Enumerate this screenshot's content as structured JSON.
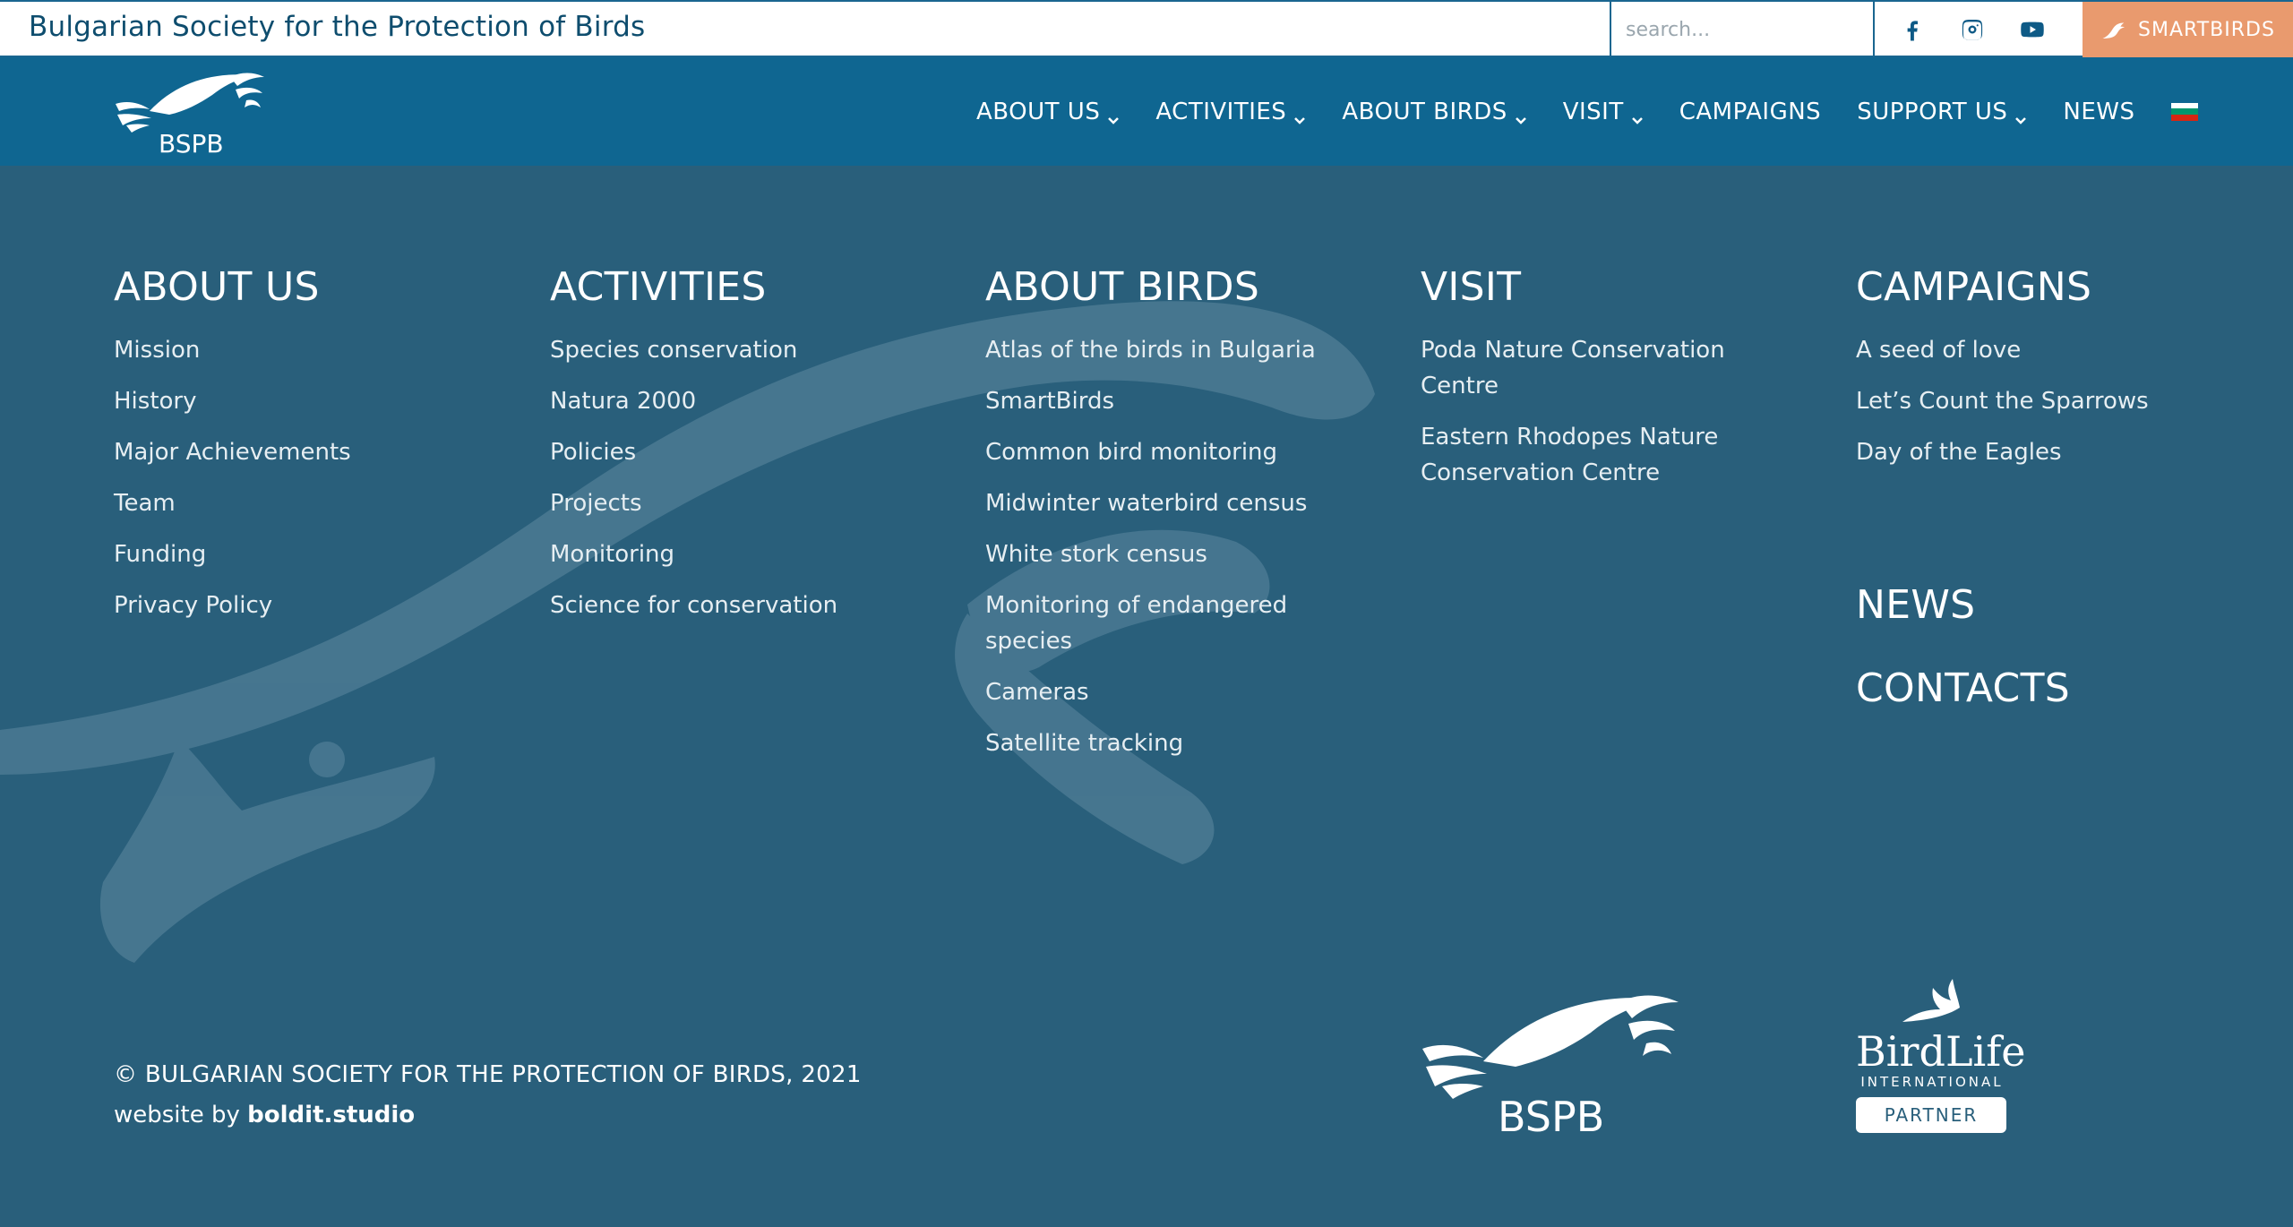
{
  "topbar": {
    "site_title": "Bulgarian Society for the Protection of Birds",
    "search_placeholder": "search...",
    "social": [
      "facebook-icon",
      "instagram-icon",
      "youtube-icon"
    ],
    "smartbirds_label": "SmartBirds"
  },
  "nav": {
    "logo_text": "BSPB",
    "items": [
      {
        "label": "About us",
        "dropdown": true
      },
      {
        "label": "Activities",
        "dropdown": true
      },
      {
        "label": "About Birds",
        "dropdown": true
      },
      {
        "label": "Visit",
        "dropdown": true
      },
      {
        "label": "Campaigns",
        "dropdown": false
      },
      {
        "label": "Support us",
        "dropdown": true
      },
      {
        "label": "News",
        "dropdown": false
      }
    ],
    "language_flag": "bulgarian-flag-icon"
  },
  "footer": {
    "columns": [
      {
        "heading": "About us",
        "links": [
          "Mission",
          "History",
          "Major Achievements",
          "Team",
          "Funding",
          "Privacy Policy"
        ]
      },
      {
        "heading": "Activities",
        "links": [
          "Species conservation",
          "Natura 2000",
          "Policies",
          "Projects",
          "Monitoring",
          "Science for conservation"
        ]
      },
      {
        "heading": "About Birds",
        "links": [
          "Atlas of the birds in Bulgaria",
          "SmartBirds",
          "Common bird monitoring",
          "Midwinter waterbird census",
          "White stork census",
          "Monitoring of endangered species",
          "Cameras",
          "Satellite tracking"
        ]
      },
      {
        "heading": "Visit",
        "links": [
          "Poda Nature Conservation Centre",
          "Eastern Rhodopes Nature Conservation Centre"
        ]
      },
      {
        "heading": "Campaigns",
        "links": [
          "A seed of love",
          "Let’s Count the Sparrows",
          "Day of the Eagles"
        ]
      }
    ],
    "news_heading": "News",
    "contacts_heading": "Contacts",
    "copyright": "© BULGARIAN SOCIETY FOR THE PROTECTION OF BIRDS, 2021",
    "credit_prefix": "website by",
    "credit_link": "boldit.studio",
    "bspb_logo_text": "BSPB",
    "birdlife_name": "BirdLife",
    "birdlife_sub": "INTERNATIONAL",
    "partner_label": "PARTNER"
  },
  "colors": {
    "nav_blue": "#0f6691",
    "footer_bg": "#295f7b",
    "accent_orange": "#e99a6e",
    "flag": [
      "#ffffff",
      "#00966e",
      "#d62612"
    ]
  }
}
